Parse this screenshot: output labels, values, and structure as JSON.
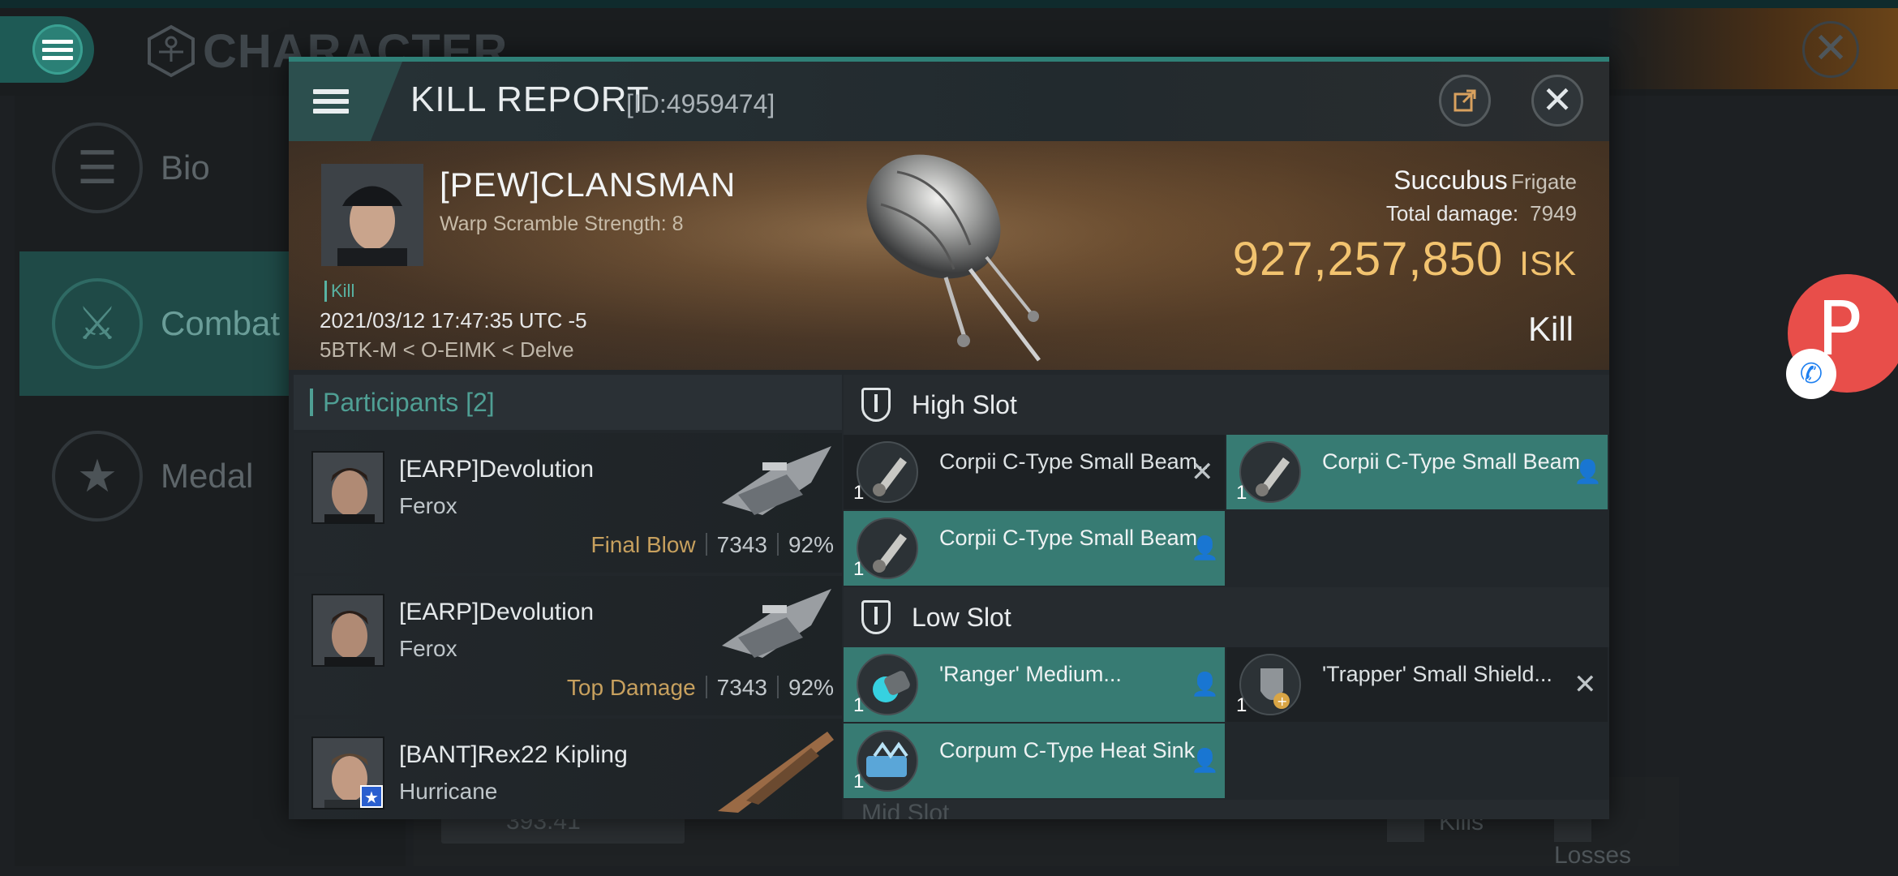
{
  "background": {
    "title": "CHARACTER",
    "sidebar": [
      {
        "label": "Bio",
        "icon": "list-icon"
      },
      {
        "label": "Combat",
        "icon": "crossed-swords-icon"
      },
      {
        "label": "Medal",
        "icon": "star-icon"
      }
    ],
    "bottom": {
      "isk_partial": "393.41",
      "kills_label": "Kills",
      "losses_label": "Losses"
    }
  },
  "report": {
    "title": "KILL REPORT",
    "id": "[ID:4959474]",
    "victim": {
      "name": "[PEW]CLANSMAN",
      "sub": "Warp Scramble Strength: 8",
      "tag": "Kill",
      "date": "2021/03/12 17:47:35 UTC -5",
      "location": "5BTK-M < O-EIMK < Delve"
    },
    "ship": {
      "name": "Succubus",
      "class": "Frigate",
      "total_damage_label": "Total damage:",
      "total_damage": "7949",
      "isk_value": "927,257,850",
      "isk_unit": "ISK",
      "outcome": "Kill"
    },
    "participants": {
      "label": "Participants",
      "count": "[2]",
      "rows": [
        {
          "name": "[EARP]Devolution",
          "ship": "Ferox",
          "tag": "Final Blow",
          "damage": "7343",
          "pct": "92%"
        },
        {
          "name": "[EARP]Devolution",
          "ship": "Ferox",
          "tag": "Top Damage",
          "damage": "7343",
          "pct": "92%"
        },
        {
          "name": "[BANT]Rex22 Kipling",
          "ship": "Hurricane",
          "tag": "",
          "damage": "",
          "pct": ""
        }
      ]
    },
    "high_slot": {
      "label": "High Slot",
      "items": [
        {
          "name": "Corpii C-Type Small Beam...",
          "qty": "1",
          "status": "destroyed"
        },
        {
          "name": "Corpii C-Type Small Beam...",
          "qty": "1",
          "status": "dropped"
        },
        {
          "name": "Corpii C-Type Small Beam...",
          "qty": "1",
          "status": "dropped"
        }
      ]
    },
    "low_slot": {
      "label": "Low Slot",
      "items": [
        {
          "name": "'Ranger' Medium...",
          "qty": "1",
          "status": "dropped"
        },
        {
          "name": "'Trapper' Small Shield...",
          "qty": "1",
          "status": "destroyed"
        },
        {
          "name": "Corpum C-Type Heat Sink",
          "qty": "1",
          "status": "dropped"
        }
      ]
    },
    "mid_slot_peek": "Mid Slot"
  },
  "colors": {
    "accent": "#2f8077",
    "isk": "#f2c36f",
    "dropped": "#377b73",
    "final_blow": "#c7a05e"
  }
}
